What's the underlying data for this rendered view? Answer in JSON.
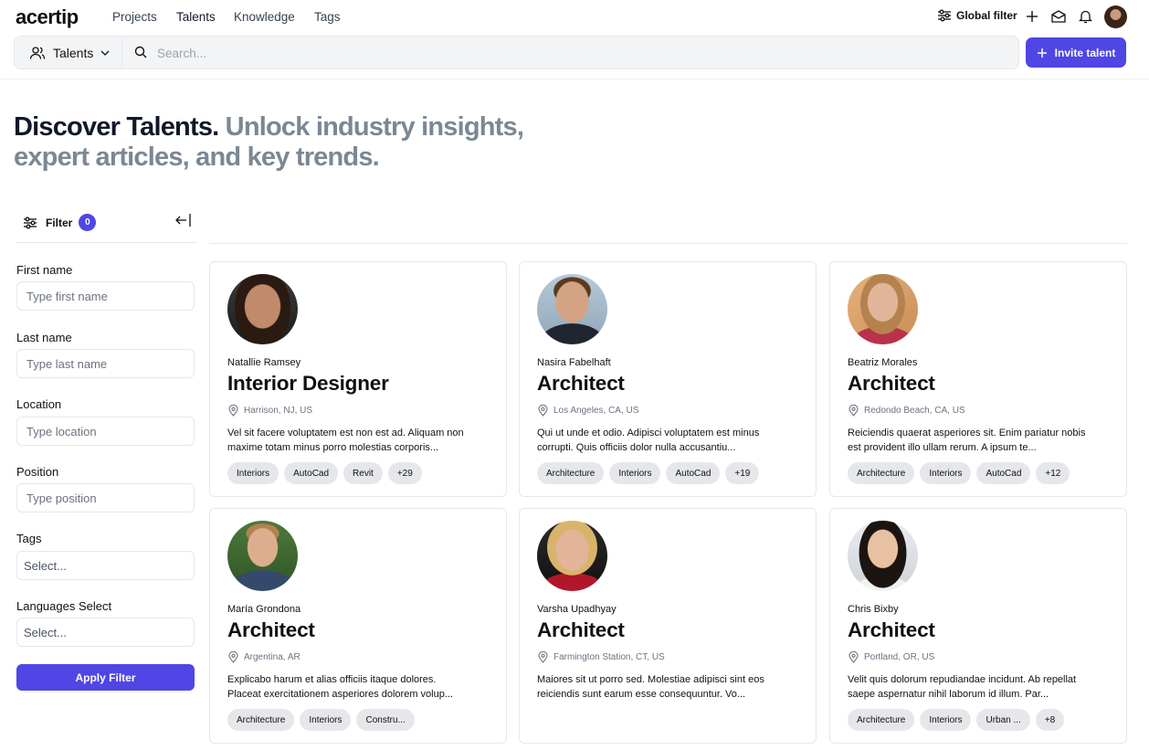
{
  "topnav": {
    "logo": "acertip",
    "links": [
      "Projects",
      "Talents",
      "Knowledge",
      "Tags"
    ],
    "global_filter": "Global filter"
  },
  "search": {
    "scope": "Talents",
    "placeholder": "Search...",
    "invite_label": "Invite talent"
  },
  "hero": {
    "dark": "Discover Talents.",
    "muted_1": "Unlock industry insights,",
    "muted_2": "expert articles, and key trends."
  },
  "filter": {
    "label": "Filter",
    "count": "0",
    "fields": [
      {
        "label": "First name",
        "placeholder": "Type first name"
      },
      {
        "label": "Last name",
        "placeholder": "Type last name"
      },
      {
        "label": "Location",
        "placeholder": "Type location"
      },
      {
        "label": "Position",
        "placeholder": "Type position"
      }
    ],
    "selects": [
      {
        "label": "Tags",
        "value": "Select..."
      },
      {
        "label": "Languages Select",
        "value": "Select..."
      }
    ],
    "apply_label": "Apply Filter"
  },
  "talents": [
    {
      "name": "Natallie Ramsey",
      "title": "Interior Designer",
      "location": "Harrison, NJ, US",
      "desc_1": "Vel sit facere voluptatem est non est ad. Aliquam non",
      "desc_2": "maxime totam minus porro molestias corporis...",
      "tags": [
        "Interiors",
        "AutoCad",
        "Revit",
        "+29"
      ]
    },
    {
      "name": "Nasira Fabelhaft",
      "title": "Architect",
      "location": "Los Angeles, CA, US",
      "desc_1": "Qui ut unde et odio. Adipisci voluptatem est minus",
      "desc_2": "corrupti. Quis officiis dolor nulla accusantiu...",
      "tags": [
        "Architecture",
        "Interiors",
        "AutoCad",
        "+19"
      ]
    },
    {
      "name": "Beatriz Morales",
      "title": "Architect",
      "location": "Redondo Beach, CA, US",
      "desc_1": "Reiciendis quaerat asperiores sit. Enim pariatur nobis",
      "desc_2": "est provident illo ullam rerum. A ipsum te...",
      "tags": [
        "Architecture",
        "Interiors",
        "AutoCad",
        "+12"
      ]
    },
    {
      "name": "María Grondona",
      "title": "Architect",
      "location": "Argentina, AR",
      "desc_1": "Explicabo harum et alias officiis itaque dolores.",
      "desc_2": "Placeat exercitationem asperiores dolorem volup...",
      "tags": [
        "Architecture",
        "Interiors",
        "Constru..."
      ]
    },
    {
      "name": "Varsha Upadhyay",
      "title": "Architect",
      "location": "Farmington Station, CT, US",
      "desc_1": "Maiores sit ut porro sed. Molestiae adipisci sint eos",
      "desc_2": "reiciendis sunt earum esse consequuntur. Vo...",
      "tags": []
    },
    {
      "name": "Chris Bixby",
      "title": "Architect",
      "location": "Portland, OR, US",
      "desc_1": "Velit quis dolorum repudiandae incidunt. Ab repellat",
      "desc_2": "saepe aspernatur nihil laborum id illum. Par...",
      "tags": [
        "Architecture",
        "Interiors",
        "Urban ...",
        "+8"
      ]
    }
  ],
  "colors": {
    "accent": "#4f46e5",
    "muted_heading": "#7b8794",
    "tag_bg": "#e5e7eb"
  }
}
